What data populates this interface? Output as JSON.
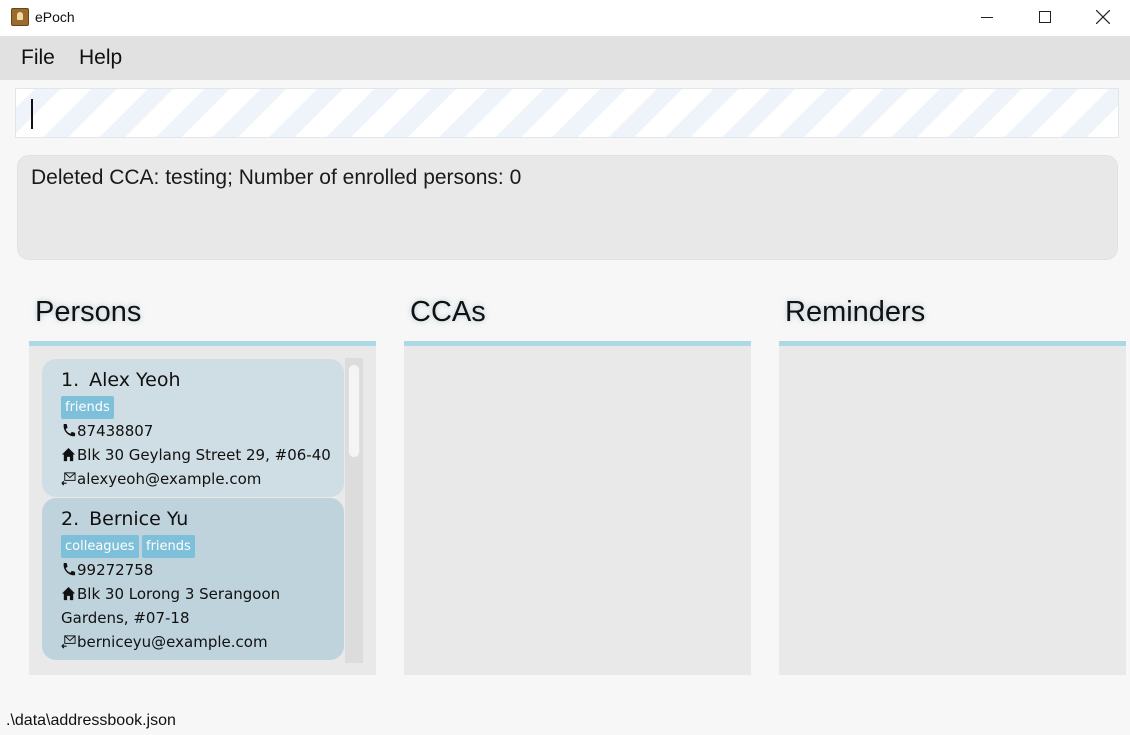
{
  "window": {
    "title": "ePoch"
  },
  "menu": {
    "file": "File",
    "help": "Help"
  },
  "command": {
    "value": "",
    "placeholder": ""
  },
  "result": {
    "message": "Deleted CCA: testing; Number of enrolled persons: 0"
  },
  "panels": {
    "persons": "Persons",
    "ccas": "CCAs",
    "reminders": "Reminders"
  },
  "persons": [
    {
      "index": "1.",
      "name": "Alex Yeoh",
      "tags": [
        "friends"
      ],
      "phone": "87438807",
      "address": "Blk 30 Geylang Street 29, #06-40",
      "email": "alexyeoh@example.com"
    },
    {
      "index": "2.",
      "name": "Bernice Yu",
      "tags": [
        "colleagues",
        "friends"
      ],
      "phone": "99272758",
      "address": "Blk 30 Lorong 3 Serangoon Gardens, #07-18",
      "email": "berniceyu@example.com"
    }
  ],
  "status": {
    "file_path": ".\\data\\addressbook.json"
  },
  "colors": {
    "panel_rule": "#add8e6",
    "tag": "#7ec0d9",
    "card_1": "#cfdde4",
    "card_2": "#bed3dc"
  }
}
